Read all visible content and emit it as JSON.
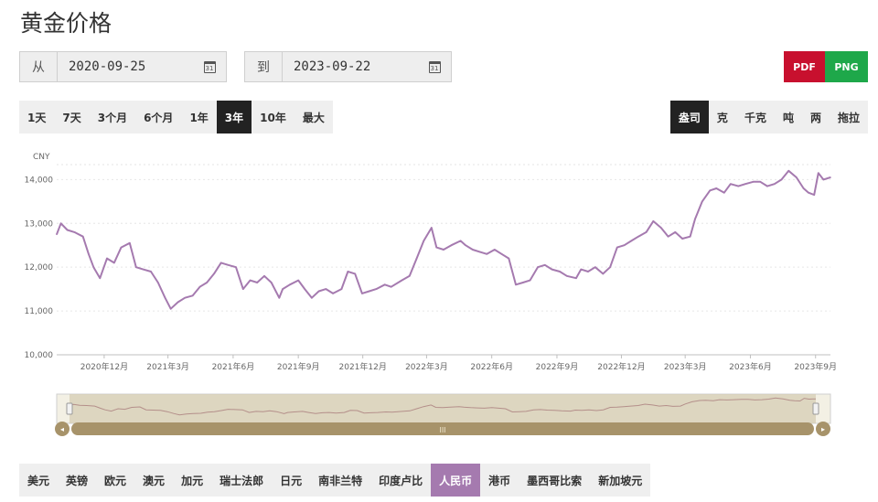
{
  "page_title": "黄金价格",
  "date_from": {
    "label": "从",
    "value": "2020-09-25"
  },
  "date_to": {
    "label": "到",
    "value": "2023-09-22"
  },
  "calendar_icon_text": "31",
  "export": {
    "pdf_label": "PDF",
    "png_label": "PNG",
    "pdf_color": "#c8102e",
    "png_color": "#1ea84a"
  },
  "ranges": {
    "items": [
      "1天",
      "7天",
      "3个月",
      "6个月",
      "1年",
      "3年",
      "10年",
      "最大"
    ],
    "active": 5
  },
  "units": {
    "items": [
      "盎司",
      "克",
      "千克",
      "吨",
      "两",
      "拖拉"
    ],
    "active": 0
  },
  "currencies": {
    "items": [
      "美元",
      "英镑",
      "欧元",
      "澳元",
      "加元",
      "瑞士法郎",
      "日元",
      "南非兰特",
      "印度卢比",
      "人民币",
      "港币",
      "墨西哥比索",
      "新加坡元"
    ],
    "active": 9
  },
  "navigator": {
    "handle_label": "III",
    "left_arrow": "◂",
    "right_arrow": "▸"
  },
  "chart_data": {
    "type": "line",
    "ylabel": "CNY",
    "ylim": [
      10000,
      14300
    ],
    "yticks": [
      10000,
      11000,
      12000,
      13000,
      14000
    ],
    "ytick_labels": [
      "10,000",
      "11,000",
      "12,000",
      "13,000",
      "14,000"
    ],
    "xlim": [
      "2020-09-25",
      "2023-09-22"
    ],
    "xticks": [
      "2020-12-01",
      "2021-03-01",
      "2021-06-01",
      "2021-09-01",
      "2021-12-01",
      "2022-03-01",
      "2022-06-01",
      "2022-09-01",
      "2022-12-01",
      "2023-03-01",
      "2023-06-01",
      "2023-09-01"
    ],
    "xtick_labels": [
      "2020年12月",
      "2021年3月",
      "2021年6月",
      "2021年9月",
      "2021年12月",
      "2022年3月",
      "2022年6月",
      "2022年9月",
      "2022年12月",
      "2023年3月",
      "2023年6月",
      "2023年9月"
    ],
    "grid": true,
    "line_color": "#a57aaf",
    "series": [
      {
        "x": [
          "2020-09-25",
          "2020-10-01",
          "2020-10-10",
          "2020-10-20",
          "2020-11-01",
          "2020-11-09",
          "2020-11-16",
          "2020-11-25",
          "2020-12-05",
          "2020-12-15",
          "2020-12-25",
          "2021-01-06",
          "2021-01-15",
          "2021-01-25",
          "2021-02-05",
          "2021-02-15",
          "2021-02-25",
          "2021-03-05",
          "2021-03-15",
          "2021-03-25",
          "2021-04-05",
          "2021-04-15",
          "2021-04-25",
          "2021-05-05",
          "2021-05-15",
          "2021-05-25",
          "2021-06-05",
          "2021-06-15",
          "2021-06-25",
          "2021-07-05",
          "2021-07-15",
          "2021-07-25",
          "2021-08-05",
          "2021-08-10",
          "2021-08-20",
          "2021-09-01",
          "2021-09-10",
          "2021-09-20",
          "2021-09-30",
          "2021-10-10",
          "2021-10-20",
          "2021-11-01",
          "2021-11-10",
          "2021-11-20",
          "2021-11-30",
          "2021-12-10",
          "2021-12-20",
          "2022-01-01",
          "2022-01-10",
          "2022-01-25",
          "2022-02-05",
          "2022-02-15",
          "2022-02-25",
          "2022-03-08",
          "2022-03-15",
          "2022-03-25",
          "2022-04-05",
          "2022-04-18",
          "2022-04-25",
          "2022-05-05",
          "2022-05-15",
          "2022-05-25",
          "2022-06-05",
          "2022-06-15",
          "2022-06-25",
          "2022-07-05",
          "2022-07-15",
          "2022-07-25",
          "2022-08-05",
          "2022-08-15",
          "2022-08-25",
          "2022-09-05",
          "2022-09-15",
          "2022-09-28",
          "2022-10-05",
          "2022-10-15",
          "2022-10-25",
          "2022-11-05",
          "2022-11-15",
          "2022-11-25",
          "2022-12-05",
          "2022-12-15",
          "2022-12-25",
          "2023-01-05",
          "2023-01-15",
          "2023-01-26",
          "2023-02-05",
          "2023-02-15",
          "2023-02-25",
          "2023-03-08",
          "2023-03-15",
          "2023-03-25",
          "2023-04-05",
          "2023-04-14",
          "2023-04-25",
          "2023-05-04",
          "2023-05-15",
          "2023-05-25",
          "2023-06-05",
          "2023-06-15",
          "2023-06-25",
          "2023-07-05",
          "2023-07-15",
          "2023-07-25",
          "2023-08-05",
          "2023-08-15",
          "2023-08-22",
          "2023-08-30",
          "2023-09-05",
          "2023-09-12",
          "2023-09-22"
        ],
        "y": [
          12750,
          13000,
          12850,
          12800,
          12700,
          12300,
          12000,
          11750,
          12200,
          12100,
          12450,
          12550,
          12000,
          11950,
          11900,
          11650,
          11300,
          11050,
          11200,
          11300,
          11350,
          11550,
          11650,
          11850,
          12100,
          12050,
          12000,
          11500,
          11700,
          11650,
          11800,
          11650,
          11300,
          11500,
          11600,
          11700,
          11500,
          11300,
          11450,
          11500,
          11400,
          11500,
          11900,
          11850,
          11400,
          11450,
          11500,
          11600,
          11550,
          11700,
          11800,
          12200,
          12600,
          12900,
          12450,
          12400,
          12500,
          12600,
          12500,
          12400,
          12350,
          12300,
          12400,
          12300,
          12200,
          11600,
          11650,
          11700,
          12000,
          12050,
          11950,
          11900,
          11800,
          11750,
          11950,
          11900,
          12000,
          11850,
          12000,
          12450,
          12500,
          12600,
          12700,
          12800,
          13050,
          12900,
          12700,
          12800,
          12650,
          12700,
          13100,
          13500,
          13750,
          13800,
          13700,
          13900,
          13850,
          13900,
          13950,
          13950,
          13850,
          13900,
          14000,
          14200,
          14050,
          13800,
          13700,
          13650,
          14150,
          14000,
          14050
        ]
      }
    ]
  }
}
